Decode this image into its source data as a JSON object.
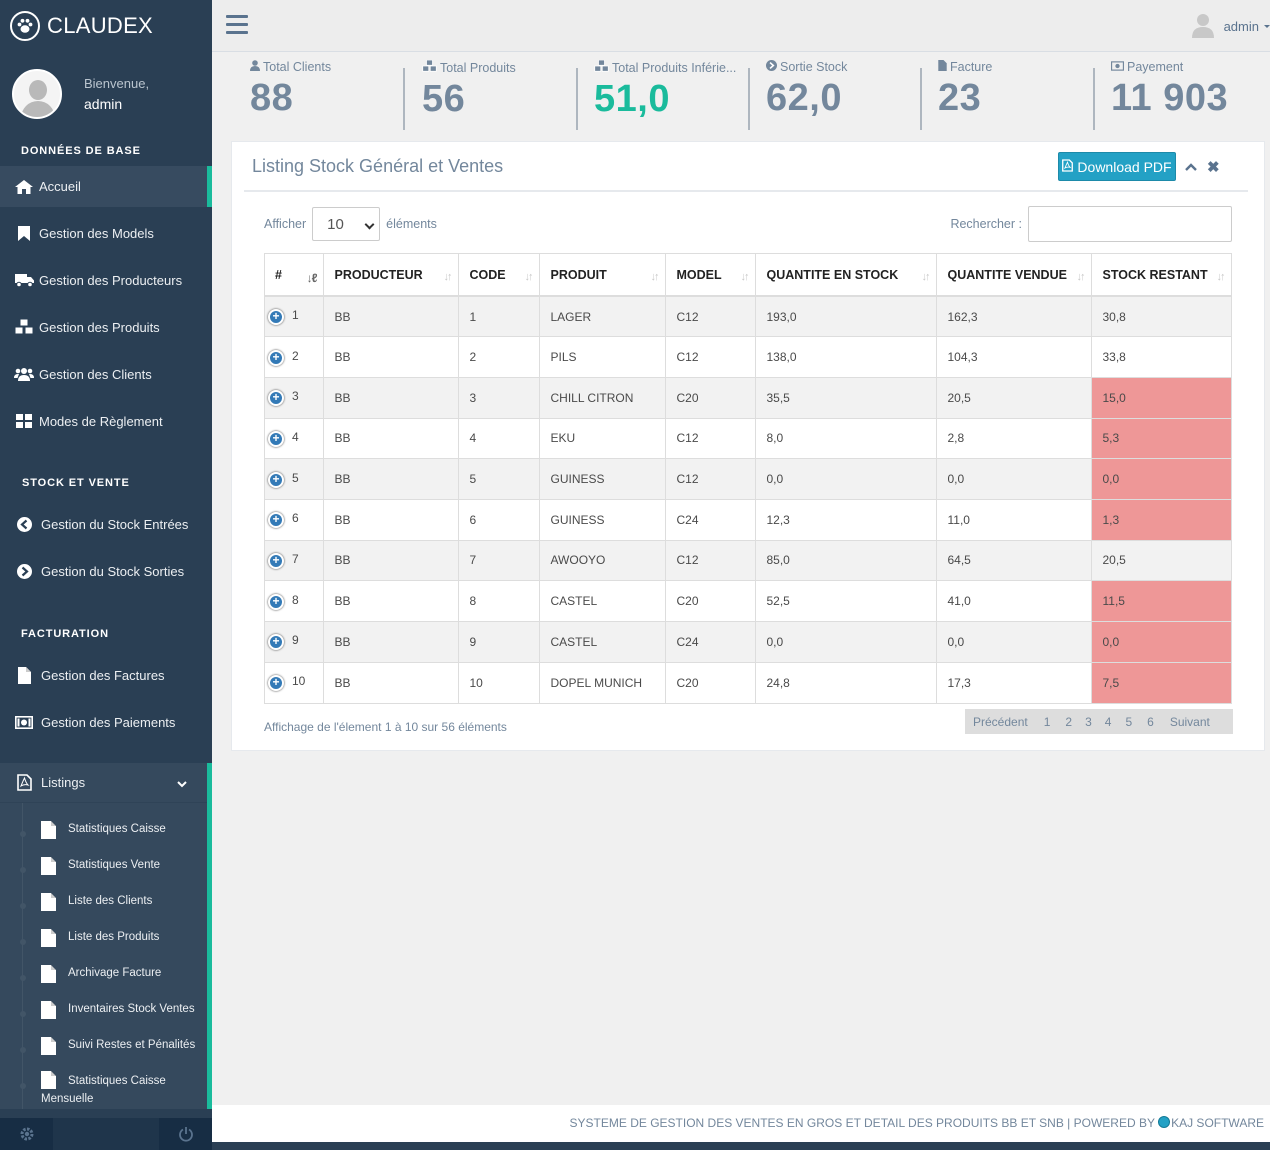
{
  "brand": {
    "name": "CLAUDEX"
  },
  "profile": {
    "welcome": "Bienvenue,",
    "username": "admin"
  },
  "sidebar": {
    "section_base": "DONNÉES DE BASE",
    "base_items": [
      {
        "label": "Accueil",
        "icon": "home-icon"
      },
      {
        "label": "Gestion des Models",
        "icon": "bookmark-icon"
      },
      {
        "label": "Gestion des Producteurs",
        "icon": "truck-icon"
      },
      {
        "label": "Gestion des Produits",
        "icon": "cubes-icon"
      },
      {
        "label": "Gestion des Clients",
        "icon": "users-icon"
      },
      {
        "label": "Modes de Règlement",
        "icon": "th-large-icon"
      }
    ],
    "section_stock": "STOCK ET VENTE",
    "stock_items": [
      {
        "label": "Gestion du Stock Entrées",
        "icon": "arrow-circle-left-icon"
      },
      {
        "label": "Gestion du Stock Sorties",
        "icon": "arrow-circle-right-icon"
      }
    ],
    "section_fact": "FACTURATION",
    "fact_items": [
      {
        "label": "Gestion des Factures",
        "icon": "file-icon"
      },
      {
        "label": "Gestion des Paiements",
        "icon": "money-icon"
      }
    ],
    "listings": {
      "label": "Listings",
      "icon": "file-pdf-icon",
      "items": [
        "Statistiques Caisse",
        "Statistiques Vente",
        "Liste des Clients",
        "Liste des Produits",
        "Archivage Facture",
        "Inventaires Stock Ventes",
        "Suivi Restes et Pénalités",
        "Statistiques Caisse Mensuelle"
      ]
    }
  },
  "topnav": {
    "user": "admin"
  },
  "tiles": [
    {
      "label": "Total Clients",
      "value": "88",
      "icon": "user-icon",
      "green": false
    },
    {
      "label": "Total Produits",
      "value": "56",
      "icon": "cubes-icon",
      "green": false
    },
    {
      "label": "Total Produits Inférie...",
      "value": "51,0",
      "icon": "cubes-icon",
      "green": true
    },
    {
      "label": "Sortie Stock",
      "value": "62,0",
      "icon": "arrow-circle-right-icon",
      "green": false
    },
    {
      "label": "Facture",
      "value": "23",
      "icon": "file-icon",
      "green": false
    },
    {
      "label": "Payement",
      "value": "11 903",
      "icon": "money-icon",
      "green": false
    }
  ],
  "panel": {
    "title": "Listing Stock Général et Ventes",
    "download_label": "Download PDF",
    "length_prefix": "Afficher",
    "length_value": "10",
    "length_suffix": "éléments",
    "search_label": "Rechercher :",
    "search_value": "",
    "colors": {
      "low_stock": "#ee9797",
      "accent": "#1abb9c",
      "button": "#23a1c5"
    }
  },
  "table": {
    "headers": [
      "#",
      "PRODUCTEUR",
      "CODE",
      "PRODUIT",
      "MODEL",
      "QUANTITE EN STOCK",
      "QUANTITE VENDUE",
      "STOCK RESTANT"
    ],
    "rows": [
      {
        "n": "1",
        "producteur": "BB",
        "code": "1",
        "produit": "LAGER",
        "model": "C12",
        "stock": "193,0",
        "vendue": "162,3",
        "restant": "30,8",
        "low": false
      },
      {
        "n": "2",
        "producteur": "BB",
        "code": "2",
        "produit": "PILS",
        "model": "C12",
        "stock": "138,0",
        "vendue": "104,3",
        "restant": "33,8",
        "low": false
      },
      {
        "n": "3",
        "producteur": "BB",
        "code": "3",
        "produit": "CHILL CITRON",
        "model": "C20",
        "stock": "35,5",
        "vendue": "20,5",
        "restant": "15,0",
        "low": true
      },
      {
        "n": "4",
        "producteur": "BB",
        "code": "4",
        "produit": "EKU",
        "model": "C12",
        "stock": "8,0",
        "vendue": "2,8",
        "restant": "5,3",
        "low": true
      },
      {
        "n": "5",
        "producteur": "BB",
        "code": "5",
        "produit": "GUINESS",
        "model": "C12",
        "stock": "0,0",
        "vendue": "0,0",
        "restant": "0,0",
        "low": true
      },
      {
        "n": "6",
        "producteur": "BB",
        "code": "6",
        "produit": "GUINESS",
        "model": "C24",
        "stock": "12,3",
        "vendue": "11,0",
        "restant": "1,3",
        "low": true
      },
      {
        "n": "7",
        "producteur": "BB",
        "code": "7",
        "produit": "AWOOYO",
        "model": "C12",
        "stock": "85,0",
        "vendue": "64,5",
        "restant": "20,5",
        "low": false
      },
      {
        "n": "8",
        "producteur": "BB",
        "code": "8",
        "produit": "CASTEL",
        "model": "C20",
        "stock": "52,5",
        "vendue": "41,0",
        "restant": "11,5",
        "low": true
      },
      {
        "n": "9",
        "producteur": "BB",
        "code": "9",
        "produit": "CASTEL",
        "model": "C24",
        "stock": "0,0",
        "vendue": "0,0",
        "restant": "0,0",
        "low": true
      },
      {
        "n": "10",
        "producteur": "BB",
        "code": "10",
        "produit": "DOPEL MUNICH",
        "model": "C20",
        "stock": "24,8",
        "vendue": "17,3",
        "restant": "7,5",
        "low": true
      }
    ]
  },
  "info": "Affichage de l'élement 1 à 10 sur 56 éléments",
  "pagination": {
    "prev": "Précédent",
    "pages": [
      "1",
      "2",
      "3",
      "4",
      "5",
      "6"
    ],
    "next": "Suivant"
  },
  "footer": {
    "text": "SYSTEME DE GESTION DES VENTES EN GROS ET DETAIL DES PRODUITS BB ET SNB | POWERED BY ",
    "company": "KAJ SOFTWARE"
  }
}
